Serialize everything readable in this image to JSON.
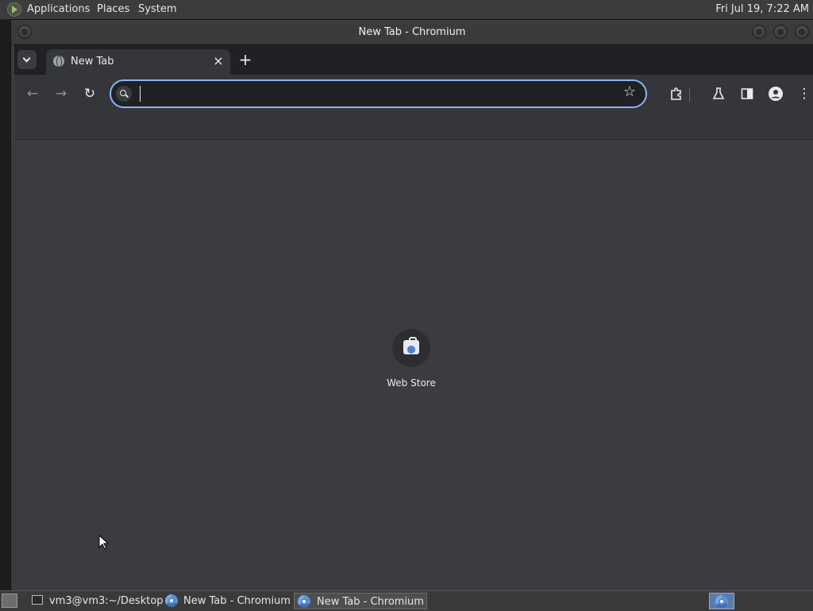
{
  "top_panel": {
    "menus": [
      "Applications",
      "Places",
      "System"
    ],
    "clock": "Fri Jul 19,  7:22 AM"
  },
  "window": {
    "title": "New Tab - Chromium"
  },
  "browser": {
    "tab": {
      "title": "New Tab",
      "close_symbol": "×"
    },
    "new_tab_symbol": "+",
    "omnibox": {
      "value": "",
      "placeholder": ""
    },
    "icons": {
      "back": "back-arrow-icon",
      "forward": "forward-arrow-icon",
      "reload": "reload-icon",
      "bookmark": "star-icon",
      "extensions": "puzzle-icon",
      "labs": "flask-icon",
      "side_panel": "side-panel-icon",
      "profile": "profile-icon",
      "menu": "kebab-menu-icon"
    }
  },
  "new_tab_page": {
    "shortcuts": [
      {
        "label": "Web Store",
        "icon": "web-store-icon"
      }
    ]
  },
  "taskbar": {
    "tasks": [
      {
        "label": "vm3@vm3:~/Desktop",
        "icon": "terminal-icon",
        "active": false
      },
      {
        "label": "New Tab - Chromium",
        "icon": "chromium-icon",
        "active": false
      },
      {
        "label": "New Tab - Chromium",
        "icon": "chromium-icon",
        "active": true
      }
    ]
  },
  "colors": {
    "accent_focus": "#8ab4f8",
    "page_background": "#3c3c40",
    "toolbar": "#35363a",
    "tabstrip": "#202124"
  }
}
